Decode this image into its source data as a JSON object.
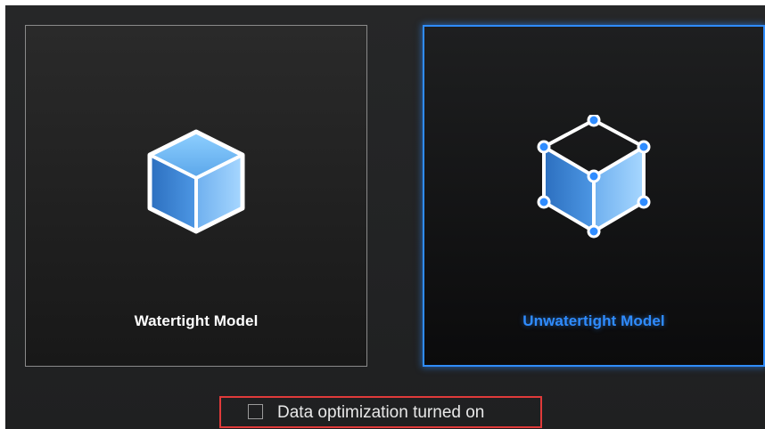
{
  "model_types": [
    {
      "label": "Watertight Model",
      "icon": "solid-cube-icon",
      "selected": false
    },
    {
      "label": "Unwatertight Model",
      "icon": "wireframe-cube-icon",
      "selected": true
    }
  ],
  "data_optimization": {
    "label": "Data optimization turned on",
    "checked": false
  },
  "colors": {
    "accent": "#2f8cff",
    "highlight_box": "#e03a3a",
    "panel_background": "#1f2021"
  }
}
